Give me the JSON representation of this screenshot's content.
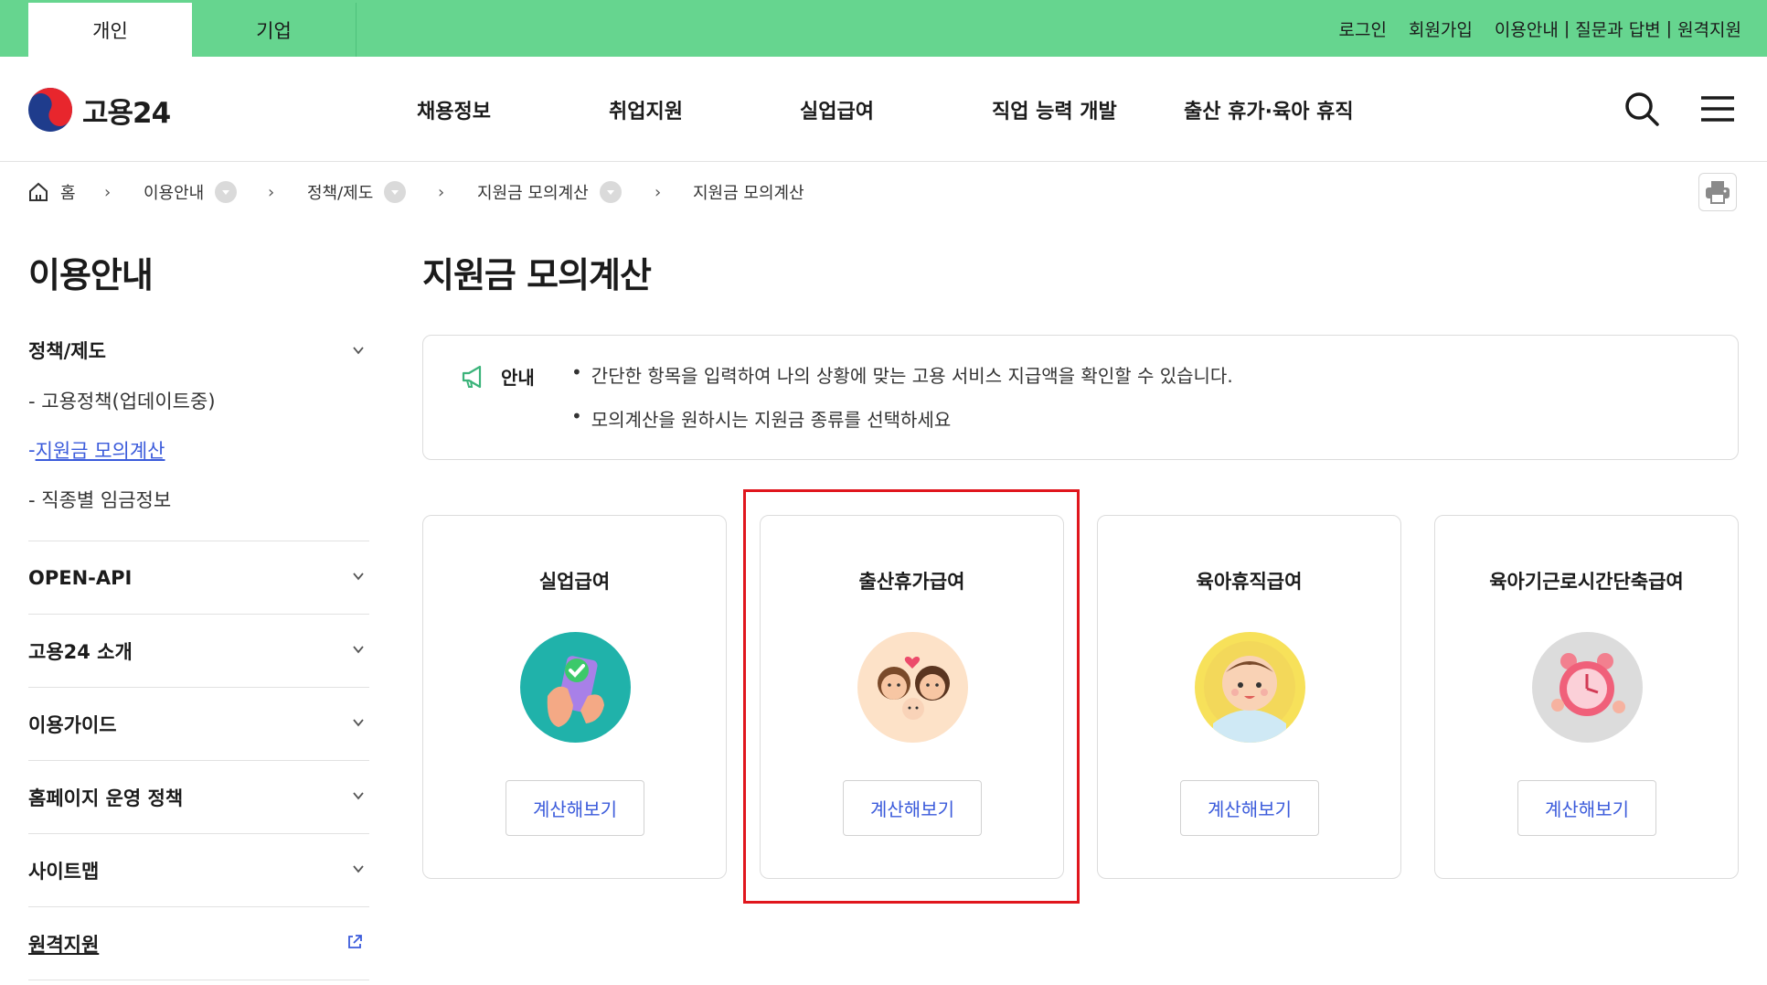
{
  "topbar": {
    "tabs": [
      {
        "label": "개인",
        "active": true
      },
      {
        "label": "기업",
        "active": false
      }
    ],
    "utility": [
      "로그인",
      "회원가입",
      "이용안내",
      "질문과 답변",
      "원격지원"
    ],
    "separator": "|"
  },
  "header": {
    "logo_text": "고용24",
    "nav": [
      "채용정보",
      "취업지원",
      "실업급여",
      "직업 능력 개발",
      "출산 휴가·육아 휴직"
    ],
    "icons": [
      "search-icon",
      "menu-icon"
    ]
  },
  "breadcrumb": {
    "home": "홈",
    "items": [
      "이용안내",
      "정책/제도",
      "지원금 모의계산"
    ],
    "current": "지원금 모의계산"
  },
  "sidebar": {
    "title": "이용안내",
    "groups": [
      {
        "label": "정책/제도",
        "sub": [
          "- 고용정책(업데이트중)",
          "지원금 모의계산",
          "- 직종별 임금정보"
        ],
        "active_prefix": "- "
      },
      {
        "label": "OPEN-API"
      },
      {
        "label": "고용24 소개"
      },
      {
        "label": "이용가이드"
      },
      {
        "label": "홈페이지 운영 정책"
      },
      {
        "label": "사이트맵"
      },
      {
        "label": "원격지원"
      }
    ]
  },
  "main": {
    "title": "지원금 모의계산",
    "notice": {
      "label": "안내",
      "items": [
        "간단한 항목을 입력하여 나의 상황에 맞는 고용 서비스 지급액을 확인할 수 있습니다.",
        "모의계산을 원하시는 지원금 종류를 선택하세요"
      ]
    },
    "cards": [
      {
        "title": "실업급여",
        "button": "계산해보기",
        "icon": "phone-hand-check-icon",
        "bg": "#20b2aa"
      },
      {
        "title": "출산휴가급여",
        "button": "계산해보기",
        "icon": "parents-baby-icon",
        "bg": "#fde2c8"
      },
      {
        "title": "육아휴직급여",
        "button": "계산해보기",
        "icon": "baby-face-icon",
        "bg": "#f7e15a"
      },
      {
        "title": "육아기근로시간단축급여",
        "button": "계산해보기",
        "icon": "alarm-clock-icon",
        "bg": "#dcdcdc"
      }
    ]
  },
  "colors": {
    "topbar": "#66d58f",
    "link": "#3b5bdb",
    "highlight": "#e0161d"
  }
}
